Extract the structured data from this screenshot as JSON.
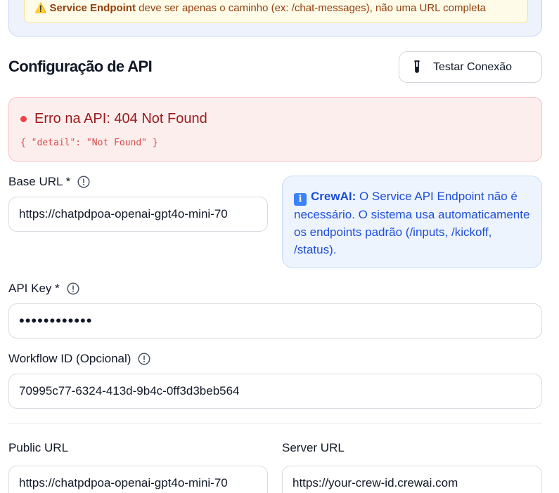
{
  "warning": {
    "bold": "Service Endpoint",
    "text": " deve ser apenas o caminho (ex: /chat-messages), não uma URL completa"
  },
  "section": {
    "title": "Configuração de API",
    "test_button": "Testar Conexão"
  },
  "error": {
    "title": "Erro na API: 404 Not Found",
    "detail": "{ \"detail\": \"Not Found\" }"
  },
  "fields": {
    "base_url": {
      "label": "Base URL *",
      "value": "https://chatpdpoa-openai-gpt4o-mini-70"
    },
    "api_key": {
      "label": "API Key *",
      "value": "••••••••••••"
    },
    "workflow_id": {
      "label": "Workflow ID (Opcional)",
      "value": "70995c77-6324-413d-9b4c-0ff3d3beb564"
    },
    "public_url": {
      "label": "Public URL",
      "value": "https://chatpdpoa-openai-gpt4o-mini-70"
    },
    "server_url": {
      "label": "Server URL",
      "value": "https://your-crew-id.crewai.com"
    }
  },
  "info_card": {
    "bold": "CrewAI:",
    "text": " O Service API Endpoint não é necessário. O sistema usa automaticamente os endpoints padrão (/inputs, /kickoff, /status)."
  },
  "colors": {
    "error_bg": "#fdeeee",
    "error_text": "#991b1b",
    "info_bg": "#eef4fd",
    "info_text": "#1d4ed8",
    "warning_bg": "#fefbe8"
  },
  "icons": [
    "warning-icon",
    "test-tube-icon",
    "error-dot-icon",
    "info-circle-icon",
    "info-square-icon"
  ]
}
